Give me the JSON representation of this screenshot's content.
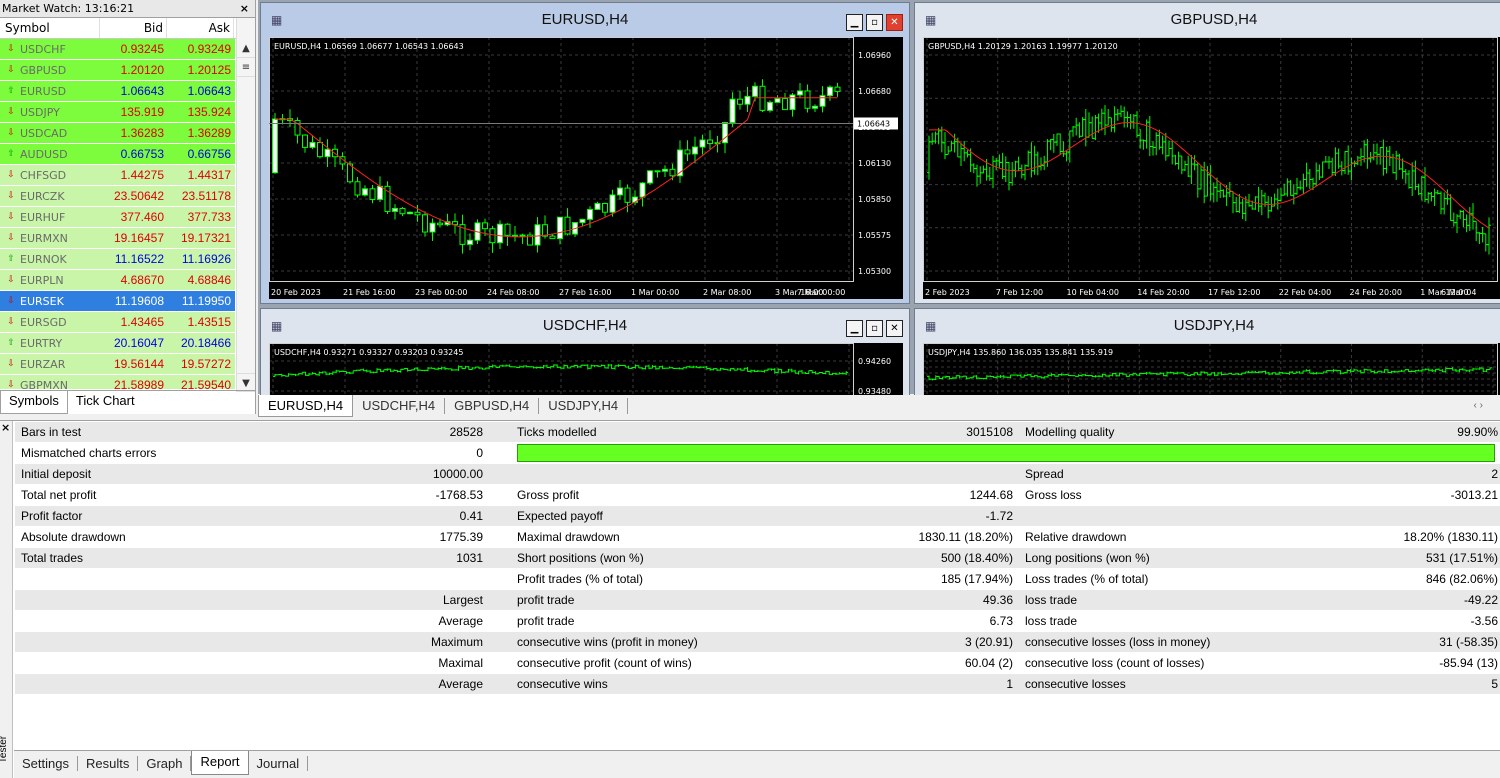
{
  "market_watch": {
    "title": "Market Watch: 13:16:21",
    "close": "×",
    "headers": [
      "Symbol",
      "Bid",
      "Ask"
    ],
    "rows": [
      {
        "symbol": "USDCHF",
        "bid": "0.93245",
        "ask": "0.93249",
        "dir": "down",
        "bg": "g1",
        "color": "red"
      },
      {
        "symbol": "GBPUSD",
        "bid": "1.20120",
        "ask": "1.20125",
        "dir": "down",
        "bg": "g1",
        "color": "red"
      },
      {
        "symbol": "EURUSD",
        "bid": "1.06643",
        "ask": "1.06643",
        "dir": "up",
        "bg": "g1",
        "color": "blue"
      },
      {
        "symbol": "USDJPY",
        "bid": "135.919",
        "ask": "135.924",
        "dir": "down",
        "bg": "g1",
        "color": "red"
      },
      {
        "symbol": "USDCAD",
        "bid": "1.36283",
        "ask": "1.36289",
        "dir": "down",
        "bg": "g1",
        "color": "red"
      },
      {
        "symbol": "AUDUSD",
        "bid": "0.66753",
        "ask": "0.66756",
        "dir": "up",
        "bg": "g1",
        "color": "blue"
      },
      {
        "symbol": "CHFSGD",
        "bid": "1.44275",
        "ask": "1.44317",
        "dir": "down",
        "bg": "g2",
        "color": "red"
      },
      {
        "symbol": "EURCZK",
        "bid": "23.50642",
        "ask": "23.51178",
        "dir": "down",
        "bg": "g2",
        "color": "red"
      },
      {
        "symbol": "EURHUF",
        "bid": "377.460",
        "ask": "377.733",
        "dir": "down",
        "bg": "g2",
        "color": "red"
      },
      {
        "symbol": "EURMXN",
        "bid": "19.16457",
        "ask": "19.17321",
        "dir": "down",
        "bg": "g2",
        "color": "red"
      },
      {
        "symbol": "EURNOK",
        "bid": "11.16522",
        "ask": "11.16926",
        "dir": "up",
        "bg": "g2",
        "color": "blue"
      },
      {
        "symbol": "EURPLN",
        "bid": "4.68670",
        "ask": "4.68846",
        "dir": "down",
        "bg": "g2",
        "color": "red"
      },
      {
        "symbol": "EURSEK",
        "bid": "11.19608",
        "ask": "11.19950",
        "dir": "down",
        "bg": "sel",
        "color": "red"
      },
      {
        "symbol": "EURSGD",
        "bid": "1.43465",
        "ask": "1.43515",
        "dir": "down",
        "bg": "g2",
        "color": "red"
      },
      {
        "symbol": "EURTRY",
        "bid": "20.16047",
        "ask": "20.18466",
        "dir": "up",
        "bg": "g2",
        "color": "blue"
      },
      {
        "symbol": "EURZAR",
        "bid": "19.56144",
        "ask": "19.57272",
        "dir": "down",
        "bg": "g2",
        "color": "red"
      },
      {
        "symbol": "GBPMXN",
        "bid": "21.58989",
        "ask": "21.59540",
        "dir": "down",
        "bg": "g2",
        "color": "red"
      }
    ],
    "tabs": [
      "Symbols",
      "Tick Chart"
    ]
  },
  "charts": {
    "eurusd": {
      "title": "EURUSD,H4",
      "info": "EURUSD,H4  1.06569 1.06677 1.06543 1.06643",
      "prices": [
        "1.06960",
        "1.06680",
        "1.06405",
        "1.06130",
        "1.05850",
        "1.05575",
        "1.05300"
      ],
      "current": "1.06643",
      "dates": [
        "20 Feb 2023",
        "21 Feb 16:00",
        "23 Feb 00:00",
        "24 Feb 08:00",
        "27 Feb 16:00",
        "1 Mar 00:00",
        "2 Mar 08:00",
        "3 Mar 16:00",
        "7 Mar 00:00"
      ]
    },
    "gbpusd": {
      "title": "GBPUSD,H4",
      "info": "GBPUSD,H4  1.20129 1.20163 1.19977 1.20120",
      "dates": [
        "2 Feb 2023",
        "7 Feb 12:00",
        "10 Feb 04:00",
        "14 Feb 20:00",
        "17 Feb 12:00",
        "22 Feb 04:00",
        "24 Feb 20:00",
        "1 Mar 12:00",
        "6 Mar 04"
      ]
    },
    "usdchf": {
      "title": "USDCHF,H4",
      "info": "USDCHF,H4  0.93271 0.93327 0.93203 0.93245",
      "prices": [
        "0.94260",
        "0.93480"
      ]
    },
    "usdjpy": {
      "title": "USDJPY,H4",
      "info": "USDJPY,H4  135.860 136.035 135.841 135.919"
    },
    "tabs": [
      "EURUSD,H4",
      "USDCHF,H4",
      "GBPUSD,H4",
      "USDJPY,H4"
    ],
    "nav": "‹  ›"
  },
  "report": {
    "rows": [
      {
        "k1": "Bars in test",
        "v1": "28528",
        "k2": "Ticks modelled",
        "v2": "3015108",
        "k3": "Modelling quality",
        "v3": "99.90%"
      },
      {
        "k1": "Mismatched charts errors",
        "v1": "0",
        "bar": true
      },
      {
        "k1": "Initial deposit",
        "v1": "10000.00",
        "k2": "",
        "v2": "",
        "k3": "Spread",
        "v3": "2"
      },
      {
        "k1": "Total net profit",
        "v1": "-1768.53",
        "k2": "Gross profit",
        "v2": "1244.68",
        "k3": "Gross loss",
        "v3": "-3013.21"
      },
      {
        "k1": "Profit factor",
        "v1": "0.41",
        "k2": "Expected payoff",
        "v2": "-1.72",
        "k3": "",
        "v3": ""
      },
      {
        "k1": "Absolute drawdown",
        "v1": "1775.39",
        "k2": "Maximal drawdown",
        "v2": "1830.11 (18.20%)",
        "k3": "Relative drawdown",
        "v3": "18.20% (1830.11)"
      },
      {
        "k1": "Total trades",
        "v1": "1031",
        "k2": "Short positions (won %)",
        "v2": "500 (18.40%)",
        "k3": "Long positions (won %)",
        "v3": "531 (17.51%)"
      },
      {
        "k1": "",
        "v1": "",
        "k2": "Profit trades (% of total)",
        "v2": "185 (17.94%)",
        "k3": "Loss trades (% of total)",
        "v3": "846 (82.06%)"
      },
      {
        "k1": "",
        "v1": "Largest",
        "k2": "profit trade",
        "v2": "49.36",
        "k3": "loss trade",
        "v3": "-49.22"
      },
      {
        "k1": "",
        "v1": "Average",
        "k2": "profit trade",
        "v2": "6.73",
        "k3": "loss trade",
        "v3": "-3.56"
      },
      {
        "k1": "",
        "v1": "Maximum",
        "k2": "consecutive wins (profit in money)",
        "v2": "3 (20.91)",
        "k3": "consecutive losses (loss in money)",
        "v3": "31 (-58.35)"
      },
      {
        "k1": "",
        "v1": "Maximal",
        "k2": "consecutive profit (count of wins)",
        "v2": "60.04 (2)",
        "k3": "consecutive loss (count of losses)",
        "v3": "-85.94 (13)"
      },
      {
        "k1": "",
        "v1": "Average",
        "k2": "consecutive wins",
        "v2": "1",
        "k3": "consecutive losses",
        "v3": "5"
      }
    ],
    "quality_fraction": 0.999
  },
  "tester": {
    "side_label": "Tester",
    "close": "×",
    "tabs": [
      "Settings",
      "Results",
      "Graph",
      "Report",
      "Journal"
    ],
    "active_tab": "Report"
  },
  "colors": {
    "bull": "#ffffff",
    "bear": "#00ff00",
    "ma": "#ff2020",
    "grid": "#3a3a3a",
    "quality_bar": "#66ff22"
  }
}
